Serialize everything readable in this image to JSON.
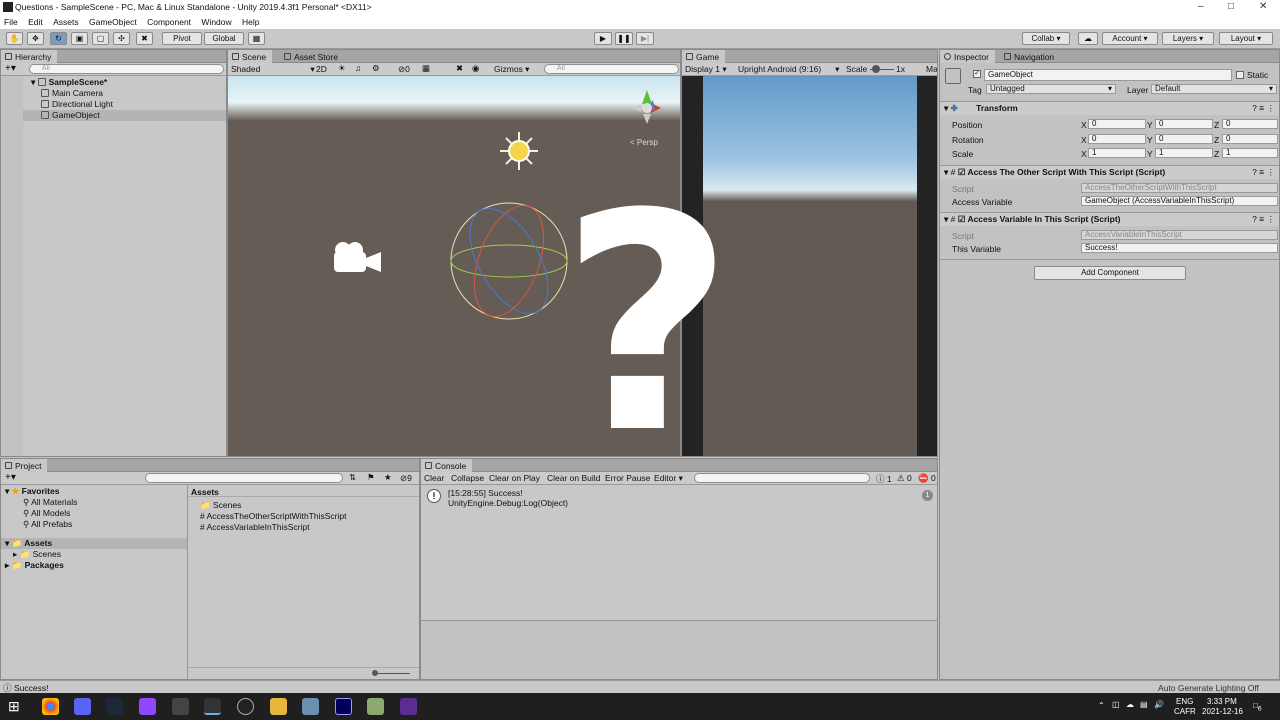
{
  "window": {
    "title": "Questions - SampleScene - PC, Mac & Linux Standalone - Unity 2019.4.3f1 Personal* <DX11>"
  },
  "menu": [
    "File",
    "Edit",
    "Assets",
    "GameObject",
    "Component",
    "Window",
    "Help"
  ],
  "toolbar": {
    "pivot": "Pivot",
    "global": "Global",
    "collab": "Collab",
    "account": "Account",
    "layers": "Layers",
    "layout": "Layout"
  },
  "hierarchy": {
    "tab": "Hierarchy",
    "search_placeholder": "All",
    "scene": "SampleScene*",
    "items": [
      "Main Camera",
      "Directional Light",
      "GameObject"
    ]
  },
  "scene": {
    "tab": "Scene",
    "store_tab": "Asset Store",
    "shading": "Shaded",
    "mode2d": "2D",
    "gizmos": "Gizmos",
    "search_placeholder": "All",
    "persp": "Persp",
    "hidden_count": "0",
    "overlay_glyph": "?"
  },
  "game": {
    "tab": "Game",
    "display": "Display 1",
    "aspect": "Upright Android (9:16)",
    "scale_label": "Scale",
    "scale_value": "1x",
    "maximize": "Ma"
  },
  "inspector": {
    "tab": "Inspector",
    "nav_tab": "Navigation",
    "object_name": "GameObject",
    "static_label": "Static",
    "tag_label": "Tag",
    "tag_value": "Untagged",
    "layer_label": "Layer",
    "layer_value": "Default",
    "transform": {
      "title": "Transform",
      "rows": [
        {
          "label": "Position",
          "x": "0",
          "y": "0",
          "z": "0"
        },
        {
          "label": "Rotation",
          "x": "0",
          "y": "0",
          "z": "0"
        },
        {
          "label": "Scale",
          "x": "1",
          "y": "1",
          "z": "1"
        }
      ]
    },
    "comp1": {
      "title": "Access The Other Script With This Script (Script)",
      "script_label": "Script",
      "script_value": "AccessTheOtherScriptWithThisScript",
      "var_label": "Access Variable",
      "var_value": "GameObject (AccessVariableInThisScript)"
    },
    "comp2": {
      "title": "Access Variable In This Script (Script)",
      "script_label": "Script",
      "script_value": "AccessVariableInThisScript",
      "var_label": "This Variable",
      "var_value": "Success!"
    },
    "add_component": "Add Component"
  },
  "project": {
    "tab": "Project",
    "favorites": "Favorites",
    "fav_items": [
      "All Materials",
      "All Models",
      "All Prefabs"
    ],
    "assets_root": "Assets",
    "asset_children": [
      "Scenes"
    ],
    "packages": "Packages",
    "breadcrumb": "Assets",
    "files": [
      "Scenes",
      "AccessTheOtherScriptWithThisScript",
      "AccessVariableInThisScript"
    ],
    "hidden_count": "9"
  },
  "console": {
    "tab": "Console",
    "buttons": [
      "Clear",
      "Collapse",
      "Clear on Play",
      "Clear on Build",
      "Error Pause",
      "Editor"
    ],
    "log_count": "1",
    "warn_count": "0",
    "err_count": "0",
    "entry_line1": "[15:28:55] Success!",
    "entry_line2": "UnityEngine.Debug:Log(Object)",
    "entry_count": "1"
  },
  "status": {
    "message": "Success!",
    "right": "Auto Generate Lighting Off"
  },
  "taskbar": {
    "lang": "ENG",
    "region": "CAFR",
    "time": "3:33 PM",
    "date": "2021-12-16",
    "notif": "6"
  },
  "colors": {
    "accent": "#3a72b0",
    "editor_bg": "#c2c2c2",
    "scene_ground": "#645c55",
    "taskbar": "#1f1f1f"
  }
}
